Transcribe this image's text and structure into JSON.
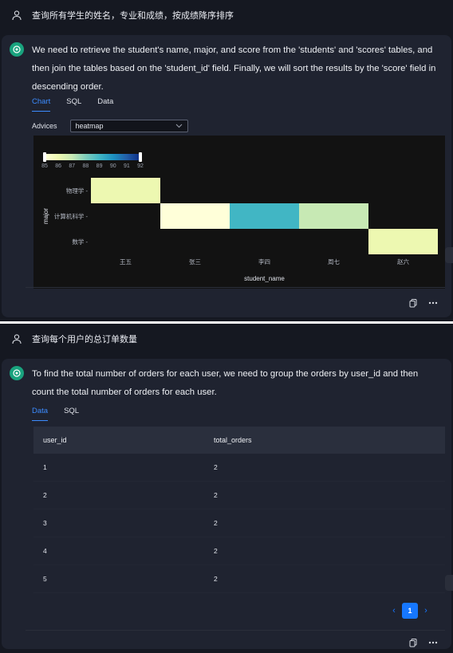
{
  "panel1": {
    "question": "查询所有学生的姓名，专业和成绩，按成绩降序排序",
    "answer": "We need to retrieve the student's name, major, and score from the 'students' and 'scores' tables, and then join the tables based on the 'student_id' field. Finally, we will sort the results by the 'score' field in descending order.",
    "tabs": [
      "Chart",
      "SQL",
      "Data"
    ],
    "active_tab": "Chart",
    "advices_label": "Advices",
    "advices_value": "heatmap"
  },
  "chart_data": {
    "type": "heatmap",
    "xlabel": "student_name",
    "ylabel": "major",
    "x_categories": [
      "王五",
      "张三",
      "李四",
      "周七",
      "赵六"
    ],
    "y_categories": [
      "物理学",
      "计算机科学",
      "数学"
    ],
    "cells": [
      {
        "x": "王五",
        "y": "物理学",
        "value": 86
      },
      {
        "x": "张三",
        "y": "计算机科学",
        "value": 85
      },
      {
        "x": "李四",
        "y": "计算机科学",
        "value": 89
      },
      {
        "x": "周七",
        "y": "计算机科学",
        "value": 87
      },
      {
        "x": "赵六",
        "y": "数学",
        "value": 86
      }
    ],
    "color_scale": {
      "min": 85,
      "max": 92,
      "ticks": [
        "85",
        "86",
        "87",
        "88",
        "89",
        "90",
        "91",
        "92"
      ],
      "colors": [
        "#ffffd9",
        "#edf8b1",
        "#c7e9b4",
        "#7fcdbb",
        "#41b6c4",
        "#1d91c0",
        "#225ea8",
        "#0c2c84"
      ]
    }
  },
  "panel2": {
    "question": "查询每个用户的总订单数量",
    "answer": "To find the total number of orders for each user, we need to group the orders by user_id and then count the total number of orders for each user.",
    "tabs": [
      "Data",
      "SQL"
    ],
    "active_tab": "Data",
    "columns": [
      "user_id",
      "total_orders"
    ],
    "rows": [
      [
        "1",
        "2"
      ],
      [
        "2",
        "2"
      ],
      [
        "3",
        "2"
      ],
      [
        "4",
        "2"
      ],
      [
        "5",
        "2"
      ]
    ],
    "current_page": "1"
  },
  "colors": {
    "background": "#151821",
    "card": "#1f2330",
    "accent": "#3c8cff",
    "ai_icon": "#19a37e"
  }
}
